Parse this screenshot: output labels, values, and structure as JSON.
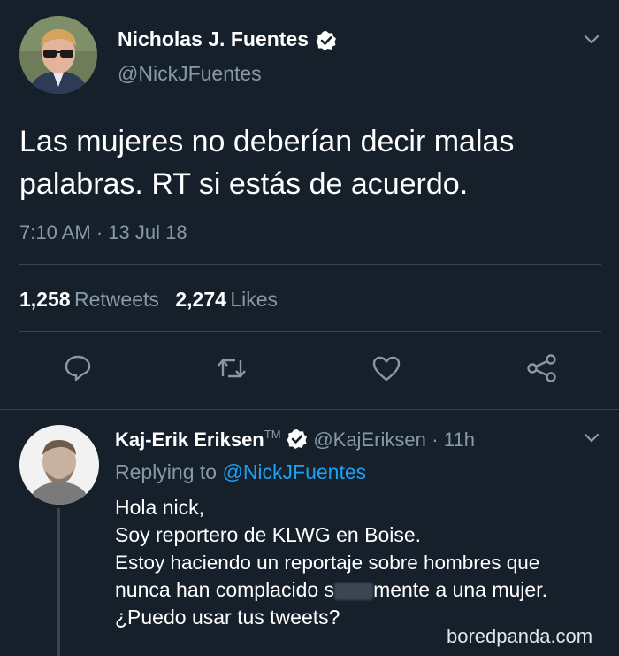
{
  "tweet": {
    "author_name": "Nicholas J. Fuentes",
    "handle": "@NickJFuentes",
    "text_line1": "Las mujeres no deberían decir malas",
    "text_line2": "palabras. RT si estás de acuerdo.",
    "timestamp": "7:10 AM · 13 Jul 18",
    "retweets_count": "1,258",
    "retweets_label": "Retweets",
    "likes_count": "2,274",
    "likes_label": "Likes"
  },
  "reply": {
    "author_name": "Kaj-Erik Eriksen",
    "name_suffix": "TM",
    "handle": "@KajEriksen",
    "separator": "·",
    "time_ago": "11h",
    "replying_prefix": "Replying to",
    "replying_to": "@NickJFuentes",
    "line1": "Hola nick,",
    "line2": "Soy reportero de KLWG en Boise.",
    "line3": "Estoy haciendo un reportaje sobre hombres que",
    "line4_start": "nunca han complacido s",
    "line4_end": "mente a una mujer.",
    "line5": "¿Puedo usar tus tweets?"
  },
  "watermark": "boredpanda.com",
  "icons": [
    "verified-badge-icon",
    "chevron-down-icon",
    "reply-icon",
    "retweet-icon",
    "like-icon",
    "share-icon"
  ],
  "colors": {
    "background": "#15202b",
    "secondary_text": "#8899a6",
    "link": "#1da1f2",
    "divider": "#38444d"
  }
}
